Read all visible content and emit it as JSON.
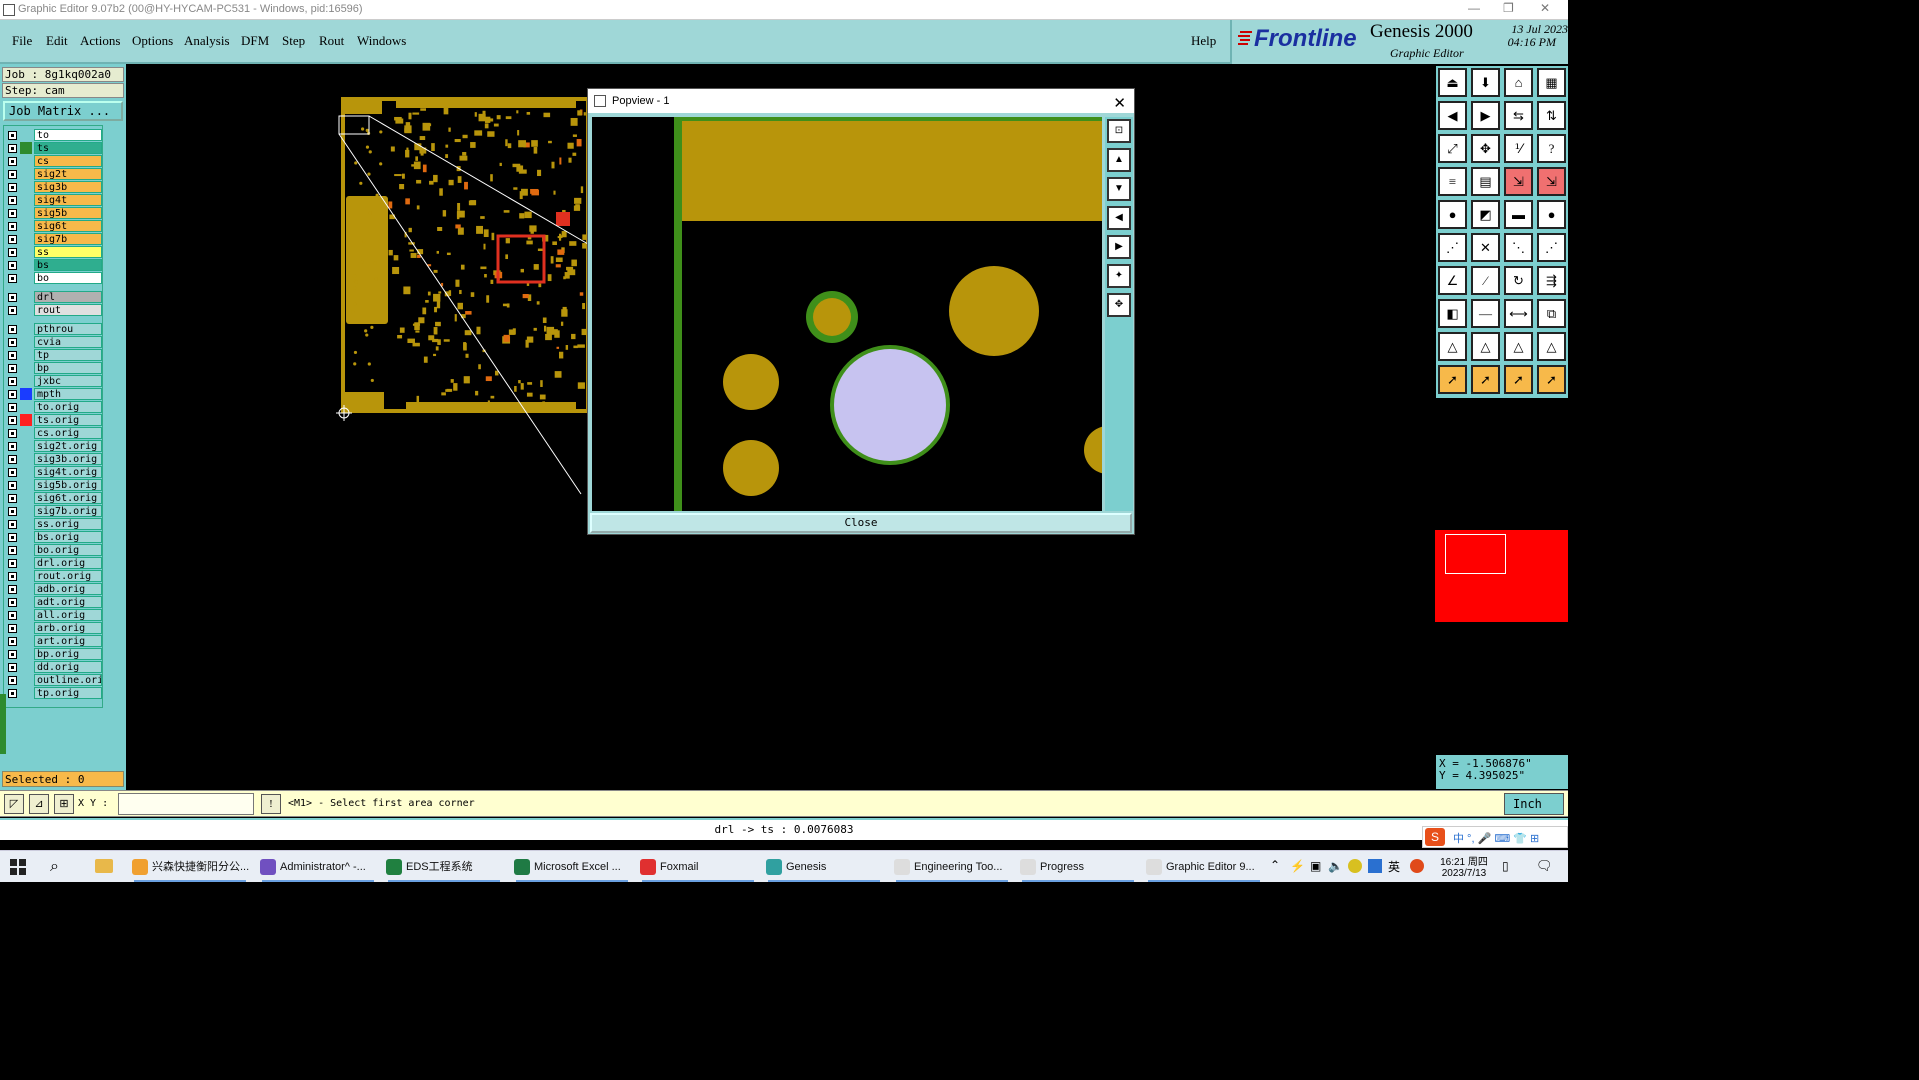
{
  "window": {
    "title": "Graphic Editor 9.07b2 (00@HY-HYCAM-PC531 - Windows, pid:16596)"
  },
  "menu": [
    "File",
    "Edit",
    "Actions",
    "Options",
    "Analysis",
    "DFM",
    "Step",
    "Rout",
    "Windows"
  ],
  "help_label": "Help",
  "brand": {
    "logo": "Frontline",
    "product": "Genesis 2000",
    "subtitle": "Graphic Editor",
    "date": "13 Jul 2023",
    "time": "04:16 PM"
  },
  "job": {
    "job_line": "Job  : 8g1kq002a0",
    "step_line": "Step:  cam",
    "matrix_button": "Job Matrix ..."
  },
  "layers": [
    {
      "name": "to",
      "color": "#ffffff"
    },
    {
      "name": "ts",
      "color": "#2fae8f",
      "mark": "#2e8b2e",
      "selected": true
    },
    {
      "name": "cs",
      "color": "#f7b94a"
    },
    {
      "name": "sig2t",
      "color": "#f7b94a"
    },
    {
      "name": "sig3b",
      "color": "#f7b94a"
    },
    {
      "name": "sig4t",
      "color": "#f7b94a"
    },
    {
      "name": "sig5b",
      "color": "#f7b94a"
    },
    {
      "name": "sig6t",
      "color": "#f7b94a"
    },
    {
      "name": "sig7b",
      "color": "#f7b94a"
    },
    {
      "name": "ss",
      "color": "#ffff66"
    },
    {
      "name": "bs",
      "color": "#2fae8f"
    },
    {
      "name": "bo",
      "color": "#ffffff"
    },
    {
      "name": "drl",
      "color": "#b0b0b0"
    },
    {
      "name": "rout",
      "color": "#e0e0e0"
    },
    {
      "name": "pthrou",
      "color": "#9fd7d7"
    },
    {
      "name": "cvia",
      "color": "#9fd7d7"
    },
    {
      "name": "tp",
      "color": "#9fd7d7"
    },
    {
      "name": "bp",
      "color": "#9fd7d7"
    },
    {
      "name": "jxbc",
      "color": "#9fd7d7"
    },
    {
      "name": "mpth",
      "color": "#9fd7d7",
      "mark": "#1a3cff"
    },
    {
      "name": "to.orig",
      "color": "#9fd7d7"
    },
    {
      "name": "ts.orig",
      "color": "#9fd7d7",
      "mark": "#ff2020"
    },
    {
      "name": "cs.orig",
      "color": "#9fd7d7"
    },
    {
      "name": "sig2t.orig",
      "color": "#9fd7d7"
    },
    {
      "name": "sig3b.orig",
      "color": "#9fd7d7"
    },
    {
      "name": "sig4t.orig",
      "color": "#9fd7d7"
    },
    {
      "name": "sig5b.orig",
      "color": "#9fd7d7"
    },
    {
      "name": "sig6t.orig",
      "color": "#9fd7d7"
    },
    {
      "name": "sig7b.orig",
      "color": "#9fd7d7"
    },
    {
      "name": "ss.orig",
      "color": "#9fd7d7"
    },
    {
      "name": "bs.orig",
      "color": "#9fd7d7"
    },
    {
      "name": "bo.orig",
      "color": "#9fd7d7"
    },
    {
      "name": "drl.orig",
      "color": "#9fd7d7"
    },
    {
      "name": "rout.orig",
      "color": "#9fd7d7"
    },
    {
      "name": "adb.orig",
      "color": "#9fd7d7"
    },
    {
      "name": "adt.orig",
      "color": "#9fd7d7"
    },
    {
      "name": "all.orig",
      "color": "#9fd7d7"
    },
    {
      "name": "arb.orig",
      "color": "#9fd7d7"
    },
    {
      "name": "art.orig",
      "color": "#9fd7d7"
    },
    {
      "name": "bp.orig",
      "color": "#9fd7d7"
    },
    {
      "name": "dd.orig",
      "color": "#9fd7d7"
    },
    {
      "name": "outline.orig",
      "color": "#9fd7d7"
    },
    {
      "name": "tp.orig",
      "color": "#9fd7d7"
    }
  ],
  "selected_label": "Selected : 0",
  "popview": {
    "title": "Popview - 1",
    "close_label": "Close"
  },
  "coords": {
    "x_line": "X = -1.506876\"",
    "y_line": "Y = 4.395025\""
  },
  "command": {
    "xy_label": "X Y :",
    "xy_value": "",
    "message": "<M1> - Select first area corner",
    "unit": "Inch"
  },
  "status_line": "drl -> ts : 0.0076083",
  "taskbar": {
    "items": [
      {
        "label": "兴森快捷衡阳分公...",
        "icon": "#f0a030"
      },
      {
        "label": "Administrator^ -...",
        "icon": "#7050c0"
      },
      {
        "label": "EDS工程系统",
        "icon": "#208040"
      },
      {
        "label": "Microsoft Excel ...",
        "icon": "#1f7a44"
      },
      {
        "label": "Foxmail",
        "icon": "#e03030"
      },
      {
        "label": "Genesis",
        "icon": "#30a0a0"
      },
      {
        "label": "Engineering Too...",
        "icon": "#ddd"
      },
      {
        "label": "Progress",
        "icon": "#ddd"
      },
      {
        "label": "Graphic Editor 9...",
        "icon": "#ddd"
      }
    ],
    "ime": "英",
    "clock_time": "16:21 周四",
    "clock_date": "2023/7/13"
  }
}
